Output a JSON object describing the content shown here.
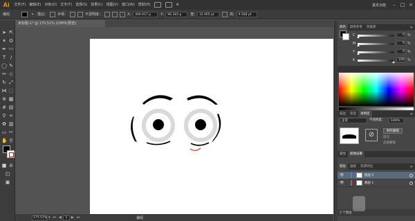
{
  "app": {
    "logo": "Ai",
    "workspace": "基本功能"
  },
  "menu": [
    "文件(F)",
    "编辑(E)",
    "对象(O)",
    "文字(T)",
    "选择(S)",
    "效果(C)",
    "视图(V)",
    "窗口(W)",
    "帮助(H)"
  ],
  "control": {
    "selection_label": "编组",
    "stroke_label": "描边：",
    "width_label": "手柄：",
    "opacity_label": "不透明度：",
    "x_value": "406.617 p",
    "y_value": "96.383 p",
    "w_value": "32.905 pt",
    "h_value": "9.568 pt"
  },
  "document": {
    "tab_title": "未标题-1* @ 175.51% (CMYK/预览)"
  },
  "status": {
    "zoom": "175.51%",
    "page": "1",
    "mode": "编组"
  },
  "panels": {
    "color_tabs": [
      "颜色",
      "颜色参考",
      "色板库"
    ],
    "sliders": [
      {
        "label": "C",
        "value": "0",
        "unit": "%"
      },
      {
        "label": "M",
        "value": "0",
        "unit": "%"
      },
      {
        "label": "Y",
        "value": "0",
        "unit": "%"
      },
      {
        "label": "K",
        "value": "100",
        "unit": "%"
      }
    ],
    "transparency_tabs": [
      "描边",
      "渐变",
      "透明度"
    ],
    "transparency": {
      "mode": "正常",
      "opacity_label": "不透明度：",
      "opacity": "100%",
      "make_mask": "制作蒙版",
      "clip": "剪切",
      "invert_mask": "反相蒙版"
    },
    "mid_tabs": [
      "属性",
      "图像描摹"
    ],
    "layer_tabs": [
      "图层",
      "画板",
      "资源导出"
    ],
    "layers": [
      {
        "name": "图层 2",
        "color": "#4f7fcf",
        "selected": true
      },
      {
        "name": "图层 1",
        "color": "#cf4f4f",
        "selected": false
      }
    ],
    "layers_count": "2 个图层"
  },
  "colors": {
    "accent": "#ff9a00",
    "selection": "#596a7d"
  }
}
